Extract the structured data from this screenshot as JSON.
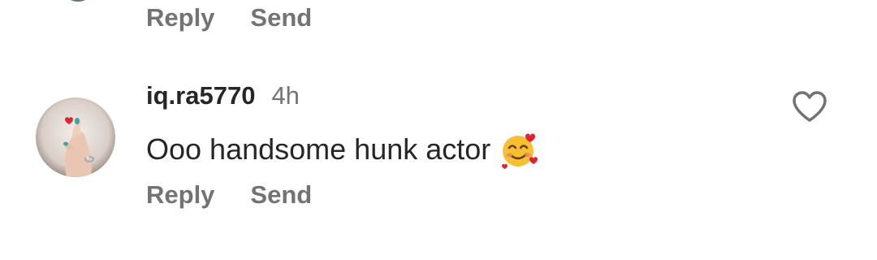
{
  "previous_comment": {
    "reply_label": "Reply",
    "send_label": "Send"
  },
  "comment": {
    "username": "iq.ra5770",
    "time": "4h",
    "text": "Ooo handsome hunk actor",
    "emoji_icon": "smiling-face-with-hearts-icon",
    "reply_label": "Reply",
    "send_label": "Send",
    "like_icon": "heart-outline-icon"
  }
}
